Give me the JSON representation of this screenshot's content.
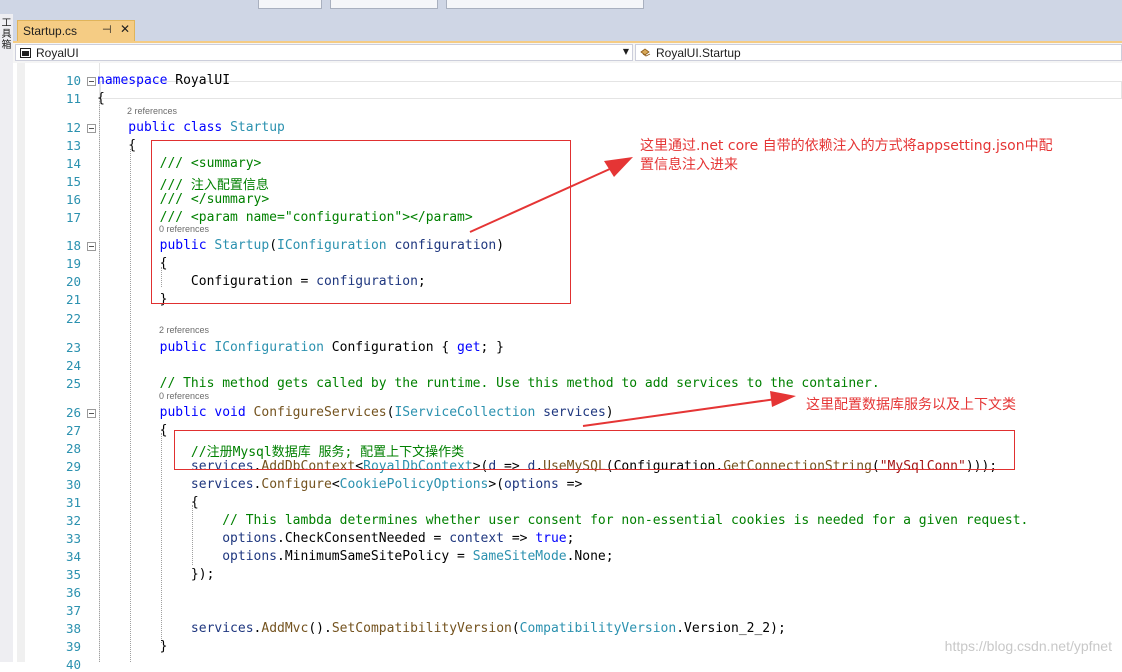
{
  "window": {
    "left_toolbar_label": "工具箱"
  },
  "tab": {
    "title": "Startup.cs",
    "pin_glyph": "⊣",
    "close_glyph": "✕"
  },
  "navbar": {
    "project": "RoyalUI",
    "type": "RoyalUI.Startup"
  },
  "editor": {
    "lines": [
      {
        "n": "10",
        "code": [
          {
            "t": "namespace ",
            "c": "kw"
          },
          {
            "t": "RoyalUI",
            "c": ""
          }
        ]
      },
      {
        "n": "11",
        "code": [
          {
            "t": "{",
            "c": ""
          }
        ]
      },
      {
        "n": "12",
        "ref": "2 references",
        "code": [
          {
            "t": "    public ",
            "c": "kw"
          },
          {
            "t": "class ",
            "c": "kw"
          },
          {
            "t": "Startup",
            "c": "ty"
          }
        ]
      },
      {
        "n": "13",
        "code": [
          {
            "t": "    {",
            "c": ""
          }
        ]
      },
      {
        "n": "14",
        "code": [
          {
            "t": "        /// <summary>",
            "c": "cm"
          }
        ]
      },
      {
        "n": "15",
        "code": [
          {
            "t": "        /// 注入配置信息",
            "c": "cm"
          }
        ]
      },
      {
        "n": "16",
        "code": [
          {
            "t": "        /// </summary>",
            "c": "cm"
          }
        ]
      },
      {
        "n": "17",
        "code": [
          {
            "t": "        /// <param name=\"configuration\"></param>",
            "c": "cm"
          }
        ]
      },
      {
        "n": "18",
        "ref": "0 references",
        "code": [
          {
            "t": "        public ",
            "c": "kw"
          },
          {
            "t": "Startup",
            "c": "ty"
          },
          {
            "t": "(",
            "c": ""
          },
          {
            "t": "IConfiguration",
            "c": "ty"
          },
          {
            "t": " ",
            "c": ""
          },
          {
            "t": "configuration",
            "c": "pm"
          },
          {
            "t": ")",
            "c": ""
          }
        ]
      },
      {
        "n": "19",
        "code": [
          {
            "t": "        {",
            "c": ""
          }
        ]
      },
      {
        "n": "20",
        "code": [
          {
            "t": "            Configuration = ",
            "c": ""
          },
          {
            "t": "configuration",
            "c": "pm"
          },
          {
            "t": ";",
            "c": ""
          }
        ]
      },
      {
        "n": "21",
        "code": [
          {
            "t": "        }",
            "c": ""
          }
        ]
      },
      {
        "n": "22",
        "code": []
      },
      {
        "n": "23",
        "ref": "2 references",
        "code": [
          {
            "t": "        public ",
            "c": "kw"
          },
          {
            "t": "IConfiguration",
            "c": "ty"
          },
          {
            "t": " Configuration { ",
            "c": ""
          },
          {
            "t": "get",
            "c": "kw"
          },
          {
            "t": "; }",
            "c": ""
          }
        ]
      },
      {
        "n": "24",
        "code": []
      },
      {
        "n": "25",
        "code": [
          {
            "t": "        // This method gets called by the runtime. Use this method to add services to the container.",
            "c": "cm"
          }
        ]
      },
      {
        "n": "26",
        "ref": "0 references",
        "code": [
          {
            "t": "        public ",
            "c": "kw"
          },
          {
            "t": "void ",
            "c": "kw"
          },
          {
            "t": "ConfigureServices",
            "c": "mt"
          },
          {
            "t": "(",
            "c": ""
          },
          {
            "t": "IServiceCollection",
            "c": "ty"
          },
          {
            "t": " ",
            "c": ""
          },
          {
            "t": "services",
            "c": "pm"
          },
          {
            "t": ")",
            "c": ""
          }
        ]
      },
      {
        "n": "27",
        "code": [
          {
            "t": "        {",
            "c": ""
          }
        ]
      },
      {
        "n": "28",
        "code": [
          {
            "t": "            //注册Mysql数据库 服务; 配置上下文操作类",
            "c": "cm"
          }
        ]
      },
      {
        "n": "29",
        "code": [
          {
            "t": "            services",
            "c": "pm"
          },
          {
            "t": ".",
            "c": ""
          },
          {
            "t": "AddDbContext",
            "c": "mt"
          },
          {
            "t": "<",
            "c": ""
          },
          {
            "t": "RoyalDbContext",
            "c": "ty"
          },
          {
            "t": ">(",
            "c": ""
          },
          {
            "t": "d",
            "c": "pm"
          },
          {
            "t": " => ",
            "c": ""
          },
          {
            "t": "d",
            "c": "pm"
          },
          {
            "t": ".",
            "c": ""
          },
          {
            "t": "UseMySQL",
            "c": "mt"
          },
          {
            "t": "(Configuration.",
            "c": ""
          },
          {
            "t": "GetConnectionString",
            "c": "mt"
          },
          {
            "t": "(",
            "c": ""
          },
          {
            "t": "\"MySqlConn\"",
            "c": "str"
          },
          {
            "t": ")));",
            "c": ""
          }
        ]
      },
      {
        "n": "30",
        "code": [
          {
            "t": "            services",
            "c": "pm"
          },
          {
            "t": ".",
            "c": ""
          },
          {
            "t": "Configure",
            "c": "mt"
          },
          {
            "t": "<",
            "c": ""
          },
          {
            "t": "CookiePolicyOptions",
            "c": "ty"
          },
          {
            "t": ">(",
            "c": ""
          },
          {
            "t": "options",
            "c": "pm"
          },
          {
            "t": " =>",
            "c": ""
          }
        ]
      },
      {
        "n": "31",
        "code": [
          {
            "t": "            {",
            "c": ""
          }
        ]
      },
      {
        "n": "32",
        "code": [
          {
            "t": "                // This lambda determines whether user consent for non-essential cookies is needed for a given request.",
            "c": "cm"
          }
        ]
      },
      {
        "n": "33",
        "code": [
          {
            "t": "                options",
            "c": "pm"
          },
          {
            "t": ".CheckConsentNeeded = ",
            "c": ""
          },
          {
            "t": "context",
            "c": "pm"
          },
          {
            "t": " => ",
            "c": ""
          },
          {
            "t": "true",
            "c": "kw"
          },
          {
            "t": ";",
            "c": ""
          }
        ]
      },
      {
        "n": "34",
        "code": [
          {
            "t": "                options",
            "c": "pm"
          },
          {
            "t": ".MinimumSameSitePolicy = ",
            "c": ""
          },
          {
            "t": "SameSiteMode",
            "c": "ty"
          },
          {
            "t": ".None;",
            "c": ""
          }
        ]
      },
      {
        "n": "35",
        "code": [
          {
            "t": "            });",
            "c": ""
          }
        ]
      },
      {
        "n": "36",
        "code": []
      },
      {
        "n": "37",
        "code": []
      },
      {
        "n": "38",
        "code": [
          {
            "t": "            services",
            "c": "pm"
          },
          {
            "t": ".",
            "c": ""
          },
          {
            "t": "AddMvc",
            "c": "mt"
          },
          {
            "t": "().",
            "c": ""
          },
          {
            "t": "SetCompatibilityVersion",
            "c": "mt"
          },
          {
            "t": "(",
            "c": ""
          },
          {
            "t": "CompatibilityVersion",
            "c": "ty"
          },
          {
            "t": ".Version_2_2);",
            "c": ""
          }
        ]
      },
      {
        "n": "39",
        "code": [
          {
            "t": "        }",
            "c": ""
          }
        ]
      },
      {
        "n": "40",
        "code": []
      }
    ]
  },
  "annotations": {
    "top_line1": "这里通过.net core 自带的依赖注入的方式将appsetting.json中配",
    "top_line2": "置信息注入进来",
    "bottom": "这里配置数据库服务以及上下文类"
  },
  "watermark": "https://blog.csdn.net/ypfnet",
  "colors": {
    "keyword": "#0000ff",
    "type": "#2b91af",
    "comment": "#008000",
    "string": "#a31515",
    "annotation": "#e53535",
    "tab_active": "#f5cc84"
  }
}
